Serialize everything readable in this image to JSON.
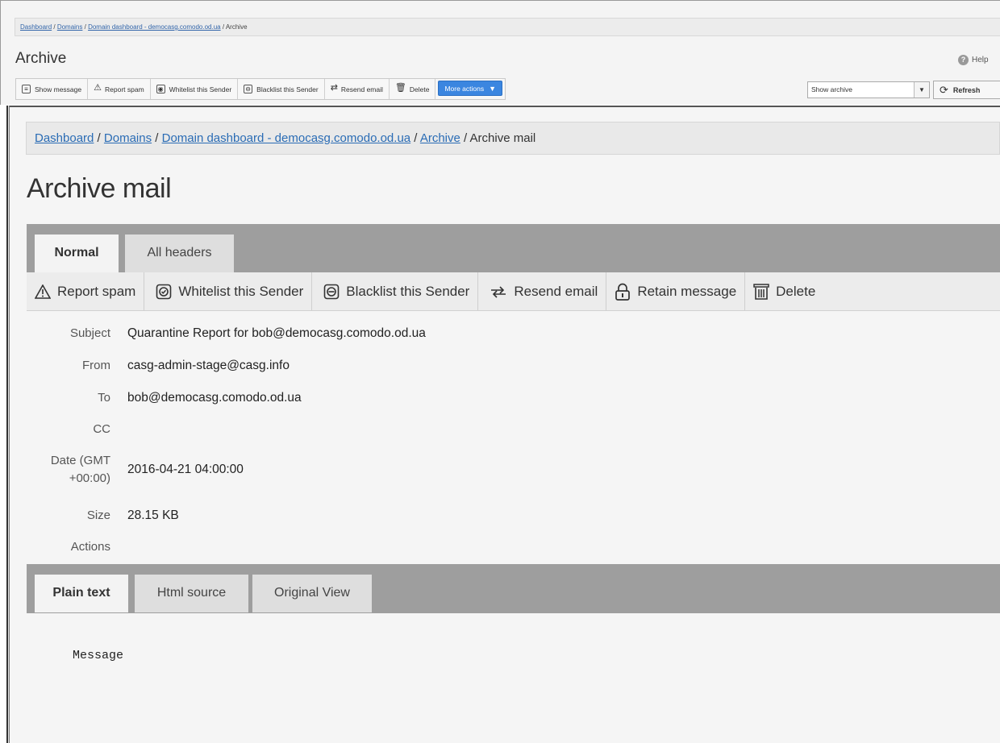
{
  "background_window": {
    "breadcrumb": [
      "Dashboard",
      "Domains",
      "Domain dashboard - democasg.comodo.od.ua",
      "Archive"
    ],
    "title": "Archive",
    "help_label": "Help",
    "toolbar": [
      {
        "label": "Show message",
        "icon": "message-icon"
      },
      {
        "label": "Report spam",
        "icon": "warning-icon"
      },
      {
        "label": "Whitelist this Sender",
        "icon": "whitelist-icon"
      },
      {
        "label": "Blacklist this Sender",
        "icon": "blacklist-icon"
      },
      {
        "label": "Resend email",
        "icon": "resend-icon"
      },
      {
        "label": "Delete",
        "icon": "trash-icon"
      },
      {
        "label": "More actions",
        "icon": "chevron-down-icon"
      }
    ],
    "view_select": "Show archive",
    "refresh_label": "Refresh"
  },
  "archive_mail": {
    "breadcrumb": [
      "Dashboard",
      "Domains",
      "Domain dashboard - democasg.comodo.od.ua",
      "Archive",
      "Archive mail"
    ],
    "title": "Archive mail",
    "tabs": [
      "Normal",
      "All headers"
    ],
    "active_tab": "Normal",
    "actions": [
      {
        "label": "Report spam",
        "icon": "warning-icon"
      },
      {
        "label": "Whitelist this Sender",
        "icon": "whitelist-icon"
      },
      {
        "label": "Blacklist this Sender",
        "icon": "blacklist-icon"
      },
      {
        "label": "Resend email",
        "icon": "resend-icon"
      },
      {
        "label": "Retain message",
        "icon": "lock-icon"
      },
      {
        "label": "Delete",
        "icon": "trash-icon"
      }
    ],
    "details": {
      "subject_label": "Subject",
      "subject": "Quarantine Report for bob@democasg.comodo.od.ua",
      "from_label": "From",
      "from": "casg-admin-stage@casg.info",
      "to_label": "To",
      "to": "bob@democasg.comodo.od.ua",
      "cc_label": "CC",
      "cc": "",
      "date_label_line1": "Date (GMT",
      "date_label_line2": "+00:00)",
      "date": "2016-04-21 04:00:00",
      "size_label": "Size",
      "size": "28.15 KB",
      "actions_label": "Actions"
    },
    "body_tabs": [
      "Plain text",
      "Html source",
      "Original View"
    ],
    "active_body_tab": "Plain text",
    "message_body": "Message"
  },
  "colors": {
    "link": "#2a6cb5",
    "more_actions_bg": "#3b86e0",
    "tab_strip_bg": "#9e9e9e"
  }
}
